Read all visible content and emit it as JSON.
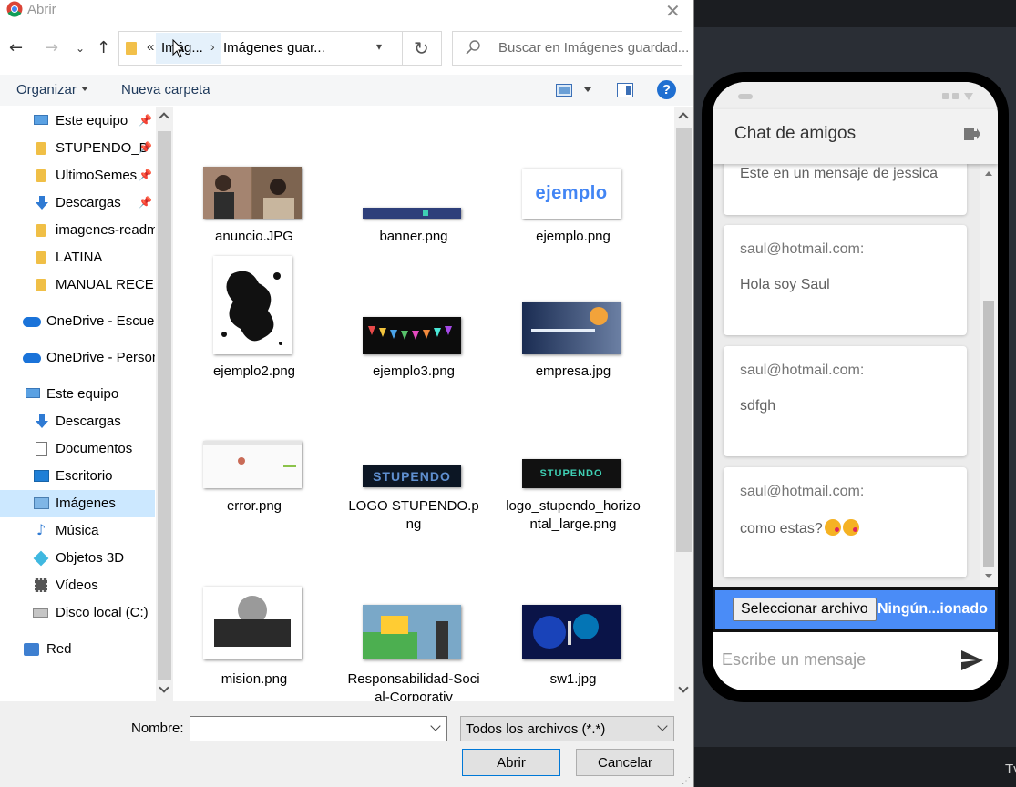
{
  "dialog": {
    "title": "Abrir",
    "close_glyph": "✕",
    "address": {
      "chevron": "«",
      "segment1": "Imág...",
      "separator": "›",
      "segment2": "Imágenes guar..."
    },
    "search_placeholder": "Buscar en Imágenes guardad...",
    "toolbar": {
      "organize": "Organizar",
      "new_folder": "Nueva carpeta",
      "help": "?"
    },
    "nav_items": [
      {
        "label": "Este equipo",
        "icon": "pc-icon",
        "pinned": true
      },
      {
        "label": "STUPENDO_D",
        "icon": "folder-icon",
        "pinned": true
      },
      {
        "label": "UltimoSemes",
        "icon": "folder-icon",
        "pinned": true
      },
      {
        "label": "Descargas",
        "icon": "download-icon",
        "pinned": true
      },
      {
        "label": "imagenes-readm",
        "icon": "folder-icon",
        "pinned": false
      },
      {
        "label": "LATINA",
        "icon": "folder-icon",
        "pinned": false
      },
      {
        "label": "MANUAL RECEP",
        "icon": "folder-icon",
        "pinned": false
      },
      {
        "label": "OneDrive - Escuela",
        "icon": "cloud-icon",
        "pinned": false
      },
      {
        "label": "OneDrive - Personal",
        "icon": "cloud-icon",
        "pinned": false
      },
      {
        "label": "Este equipo",
        "icon": "pc-icon",
        "pinned": false
      },
      {
        "label": "Descargas",
        "icon": "download-icon",
        "pinned": false
      },
      {
        "label": "Documentos",
        "icon": "documents-icon",
        "pinned": false
      },
      {
        "label": "Escritorio",
        "icon": "desktop-icon",
        "pinned": false
      },
      {
        "label": "Imágenes",
        "icon": "pictures-icon",
        "pinned": false,
        "selected": true
      },
      {
        "label": "Música",
        "icon": "music-icon",
        "pinned": false
      },
      {
        "label": "Objetos 3D",
        "icon": "3d-objects-icon",
        "pinned": false
      },
      {
        "label": "Vídeos",
        "icon": "videos-icon",
        "pinned": false
      },
      {
        "label": "Disco local (C:)",
        "icon": "disk-icon",
        "pinned": false
      },
      {
        "label": "Red",
        "icon": "network-icon",
        "pinned": false
      }
    ],
    "files": [
      {
        "name": "anuncio.JPG"
      },
      {
        "name": "banner.png"
      },
      {
        "name": "ejemplo.png"
      },
      {
        "name": "ejemplo2.png"
      },
      {
        "name": "ejemplo3.png"
      },
      {
        "name": "empresa.jpg"
      },
      {
        "name": "error.png"
      },
      {
        "name": "LOGO STUPENDO.png"
      },
      {
        "name": "logo_stupendo_horizontal_large.png"
      },
      {
        "name": "mision.png"
      },
      {
        "name": "Responsabilidad-Social-Corporativ"
      },
      {
        "name": "sw1.jpg"
      }
    ],
    "thumb_text": {
      "ejemplo": "ejemplo",
      "stupendo": "STUPENDO",
      "stupendo_upper": "STUPENDO"
    },
    "name_label": "Nombre:",
    "name_value": "",
    "filter": "Todos los archivos (*.*)",
    "open_label": "Abrir",
    "cancel_label": "Cancelar"
  },
  "chat": {
    "title": "Chat de amigos",
    "messages": [
      {
        "sender": "",
        "text": "Este en un mensaje de jessica"
      },
      {
        "sender": "saul@hotmail.com:",
        "text": "Hola soy Saul"
      },
      {
        "sender": "saul@hotmail.com:",
        "text": "sdfgh"
      },
      {
        "sender": "saul@hotmail.com:",
        "text": "como estas?"
      }
    ],
    "file_button": "Seleccionar archivo",
    "file_status": "Ningún...ionado",
    "compose_placeholder": "Escribe un mensaje"
  },
  "background": {
    "bottom_text": "Tv"
  },
  "colors": {
    "accent": "#4a8cf7",
    "selection": "#cce8ff",
    "help": "#1f6fd1"
  }
}
